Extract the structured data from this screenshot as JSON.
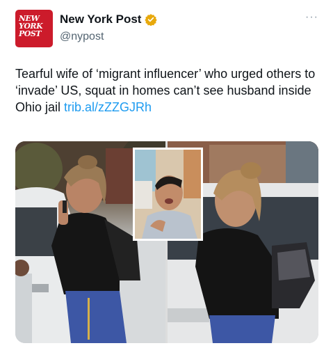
{
  "account": {
    "display_name": "New York Post",
    "handle": "@nypost",
    "avatar_text_lines": [
      "NEW",
      "YORK",
      "POST"
    ],
    "verified_color": "#e8a90c"
  },
  "more_label": "···",
  "tweet": {
    "text": "Tearful wife of ‘migrant influencer’ who urged others to ‘invade’ US, squat in homes can’t see husband inside Ohio jail ",
    "link": "trib.al/zZZGJRh",
    "link_color": "#1d9bf0"
  },
  "media": {
    "photos": [
      {
        "label": "woman-on-phone-photo"
      },
      {
        "label": "man-selfie-inset-photo"
      },
      {
        "label": "woman-walking-photo"
      }
    ]
  }
}
